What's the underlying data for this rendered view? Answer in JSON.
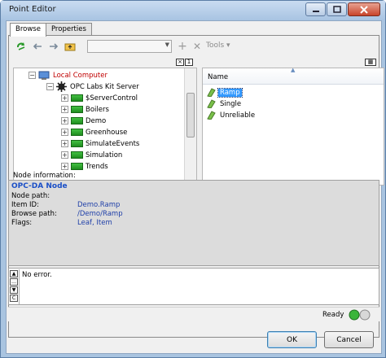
{
  "window": {
    "title": "Point Editor",
    "controls": [
      "minimize-icon",
      "maximize-icon",
      "close-icon"
    ]
  },
  "tabs": [
    {
      "label": "Browse",
      "active": true
    },
    {
      "label": "Properties",
      "active": false
    }
  ],
  "toolbar": {
    "icons": [
      "refresh-icon",
      "back-icon",
      "forward-icon",
      "up-folder-icon",
      "add-icon",
      "delete-icon"
    ],
    "combo_value": "",
    "tools_label": "Tools"
  },
  "tree": {
    "root": "Local Computer",
    "server": "OPC Labs Kit Server",
    "items": [
      "$ServerControl",
      "Boilers",
      "Demo",
      "Greenhouse",
      "SimulateEvents",
      "Simulation",
      "Trends"
    ]
  },
  "list": {
    "header_name": "Name",
    "items": [
      {
        "label": "Ramp",
        "selected": true
      },
      {
        "label": "Single",
        "selected": false
      },
      {
        "label": "Unreliable",
        "selected": false
      }
    ]
  },
  "node_info": {
    "label": "Node information:",
    "heading": "OPC-DA Node",
    "node_path_label": "Node path:",
    "item_id_label": "Item ID:",
    "item_id_value": "Demo.Ramp",
    "browse_path_label": "Browse path:",
    "browse_path_value": "/Demo/Ramp",
    "flags_label": "Flags:",
    "flags_value": "Leaf, Item"
  },
  "messages": {
    "text": "No error."
  },
  "status": {
    "text": "Ready"
  },
  "buttons": {
    "ok": "OK",
    "cancel": "Cancel"
  },
  "colors": {
    "selection": "#3399ff",
    "node_heading": "#1a4fc7",
    "link_blue": "#1f3fa8",
    "tree_root": "#c00000"
  }
}
